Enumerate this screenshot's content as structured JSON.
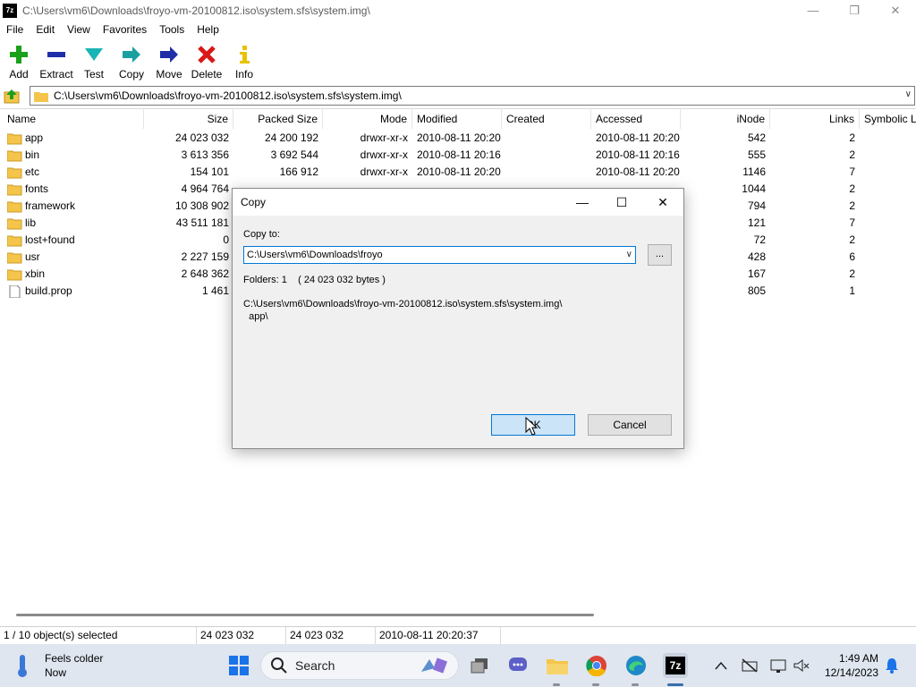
{
  "window": {
    "title": "C:\\Users\\vm6\\Downloads\\froyo-vm-20100812.iso\\system.sfs\\system.img\\",
    "app_icon_text": "7z"
  },
  "menu": [
    "File",
    "Edit",
    "View",
    "Favorites",
    "Tools",
    "Help"
  ],
  "toolbar": {
    "add": "Add",
    "extract": "Extract",
    "test": "Test",
    "copy": "Copy",
    "move": "Move",
    "delete": "Delete",
    "info": "Info"
  },
  "address": {
    "path": "C:\\Users\\vm6\\Downloads\\froyo-vm-20100812.iso\\system.sfs\\system.img\\"
  },
  "columns": {
    "name": "Name",
    "size": "Size",
    "packed": "Packed Size",
    "mode": "Mode",
    "modified": "Modified",
    "created": "Created",
    "accessed": "Accessed",
    "inode": "iNode",
    "links": "Links",
    "symlink": "Symbolic L"
  },
  "rows": [
    {
      "name": "app",
      "size": "24 023 032",
      "packed": "24 200 192",
      "mode": "drwxr-xr-x",
      "modified": "2010-08-11 20:20",
      "created": "",
      "accessed": "2010-08-11 20:20",
      "inode": "542",
      "links": "2",
      "folder": true
    },
    {
      "name": "bin",
      "size": "3 613 356",
      "packed": "3 692 544",
      "mode": "drwxr-xr-x",
      "modified": "2010-08-11 20:16",
      "created": "",
      "accessed": "2010-08-11 20:16",
      "inode": "555",
      "links": "2",
      "folder": true
    },
    {
      "name": "etc",
      "size": "154 101",
      "packed": "166 912",
      "mode": "drwxr-xr-x",
      "modified": "2010-08-11 20:20",
      "created": "",
      "accessed": "2010-08-11 20:20",
      "inode": "1146",
      "links": "7",
      "folder": true
    },
    {
      "name": "fonts",
      "size": "4 964 764",
      "packed": "",
      "mode": "",
      "modified": "",
      "created": "",
      "accessed": "",
      "inode": "1044",
      "links": "2",
      "folder": true
    },
    {
      "name": "framework",
      "size": "10 308 902",
      "packed": "",
      "mode": "",
      "modified": "",
      "created": "",
      "accessed": "",
      "inode": "794",
      "links": "2",
      "folder": true
    },
    {
      "name": "lib",
      "size": "43 511 181",
      "packed": "",
      "mode": "",
      "modified": "",
      "created": "",
      "accessed": "",
      "inode": "121",
      "links": "7",
      "folder": true
    },
    {
      "name": "lost+found",
      "size": "0",
      "packed": "",
      "mode": "",
      "modified": "",
      "created": "",
      "accessed": "",
      "inode": "72",
      "links": "2",
      "folder": true
    },
    {
      "name": "usr",
      "size": "2 227 159",
      "packed": "",
      "mode": "",
      "modified": "",
      "created": "",
      "accessed": "",
      "inode": "428",
      "links": "6",
      "folder": true
    },
    {
      "name": "xbin",
      "size": "2 648 362",
      "packed": "",
      "mode": "",
      "modified": "",
      "created": "",
      "accessed": "",
      "inode": "167",
      "links": "2",
      "folder": true
    },
    {
      "name": "build.prop",
      "size": "1 461",
      "packed": "",
      "mode": "",
      "modified": "",
      "created": "",
      "accessed": "",
      "inode": "805",
      "links": "1",
      "folder": false
    }
  ],
  "status": {
    "selected": "1 / 10 object(s) selected",
    "size": "24 023 032",
    "packed": "24 023 032",
    "date": "2010-08-11 20:20:37"
  },
  "dialog": {
    "title": "Copy",
    "copy_to_label": "Copy to:",
    "destination": "C:\\Users\\vm6\\Downloads\\froyo",
    "browse": "...",
    "info": "Folders: 1    ( 24 023 032 bytes )",
    "source_line1": "C:\\Users\\vm6\\Downloads\\froyo-vm-20100812.iso\\system.sfs\\system.img\\",
    "source_line2": "  app\\",
    "ok": "OK",
    "cancel": "Cancel"
  },
  "taskbar": {
    "weather_line1": "Feels colder",
    "weather_line2": "Now",
    "search": "Search",
    "time": "1:49 AM",
    "date": "12/14/2023"
  },
  "colors": {
    "add": "#1aa01a",
    "extract": "#1f2fa8",
    "test": "#19b4b4",
    "copy": "#1aa0a0",
    "move": "#1f2fa8",
    "delete": "#d81818",
    "info": "#e8c200",
    "folder": "#f4c54a",
    "accent": "#0078d7",
    "taskbar": "#dfe6ef"
  }
}
